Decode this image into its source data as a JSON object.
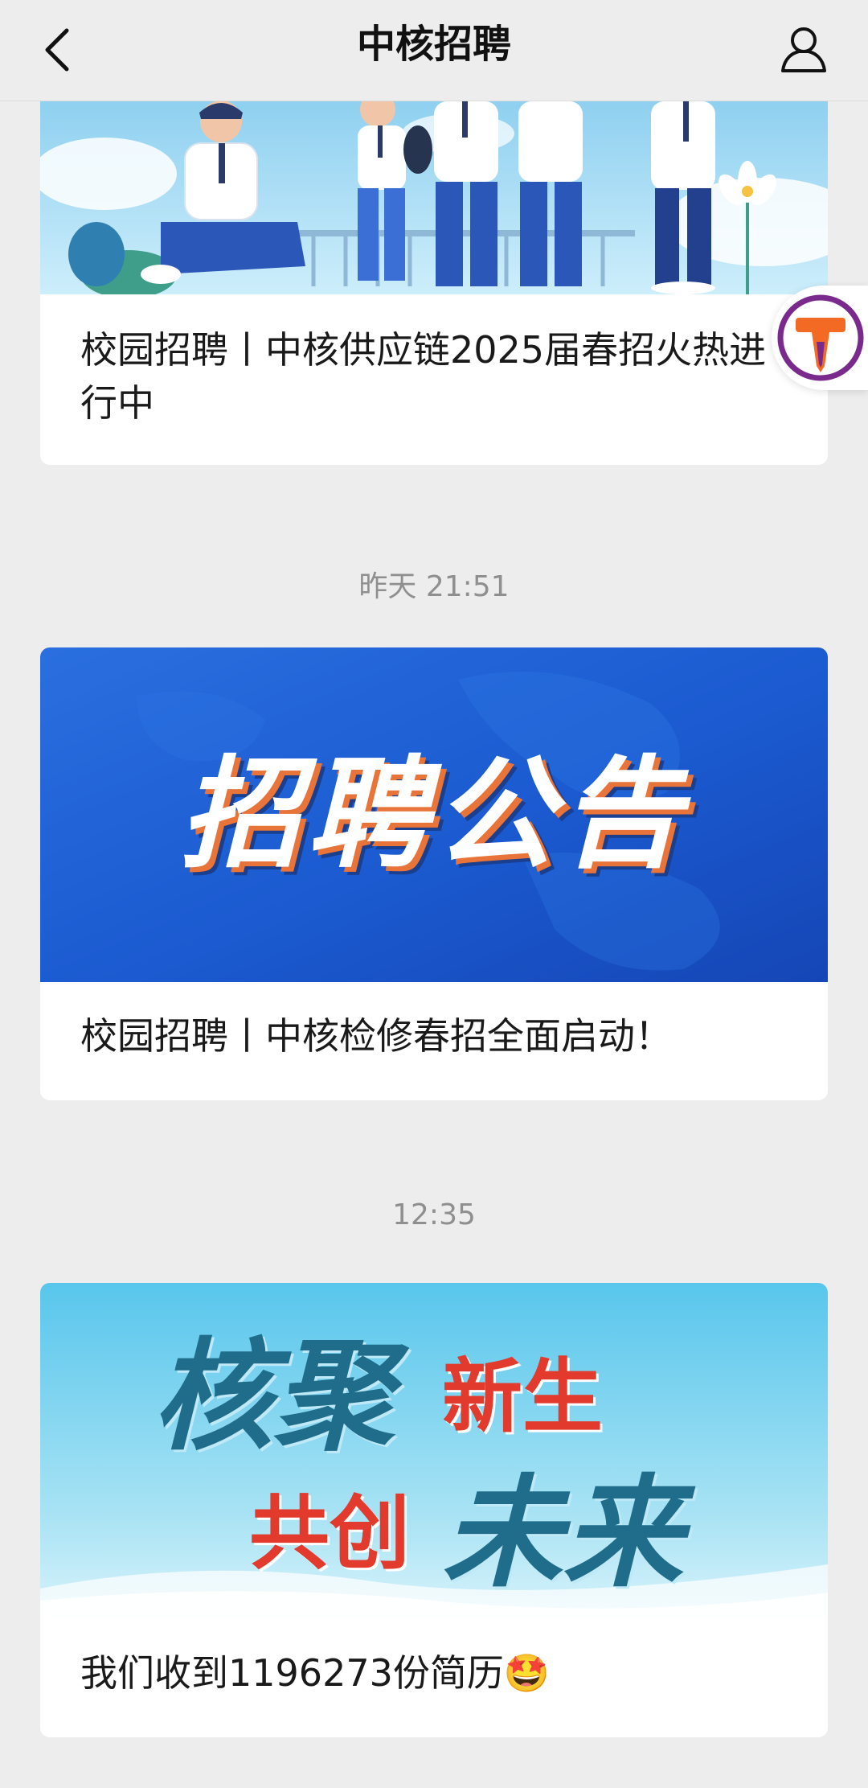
{
  "header": {
    "title": "中核招聘",
    "back_icon": "chevron-left-icon",
    "profile_icon": "user-icon"
  },
  "articles": [
    {
      "caption": "校园招聘丨中核供应链2025届春招火热进行中",
      "banner_alt": "campus-students-illustration"
    },
    {
      "time": "昨天 21:51",
      "caption": "校园招聘丨中核检修春招全面启动！",
      "banner_text": "招聘公告"
    },
    {
      "time": "12:35",
      "caption": "我们收到1196273份简历🤩",
      "banner_text_1": "核聚",
      "banner_text_2": "新生",
      "banner_text_3": "共创",
      "banner_text_4": "未来"
    }
  ],
  "floating_button": {
    "icon": "t-logo-icon",
    "letter": "T"
  },
  "colors": {
    "background": "#ededed",
    "card": "#ffffff",
    "time_text": "#8f8f8f",
    "banner2_blue": "#1d5fd6",
    "banner3_sky": "#6fd0ee",
    "banner3_red": "#e23a2c",
    "banner3_teal": "#1f6d8a"
  }
}
